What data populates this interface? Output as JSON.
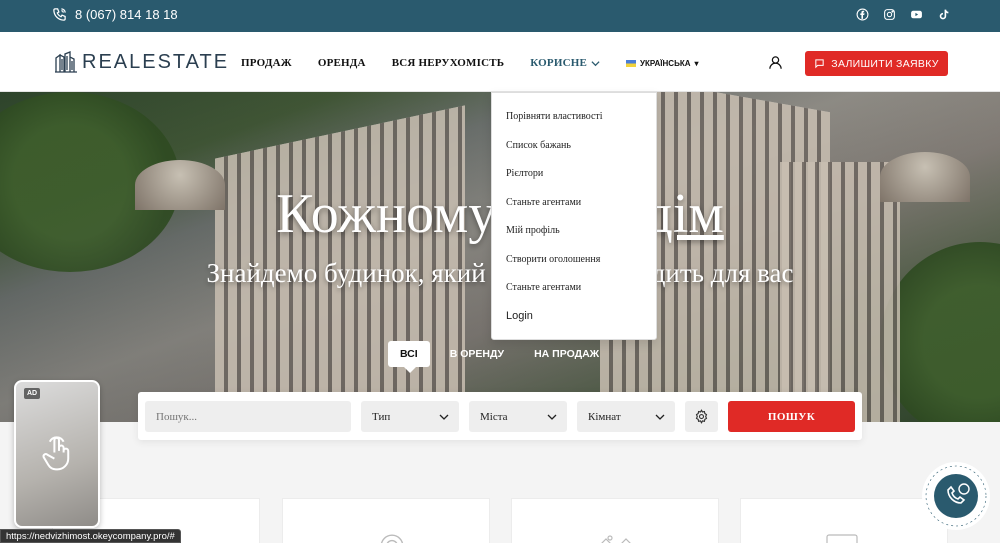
{
  "topbar": {
    "phone": "8 (067) 814 18 18",
    "socials": [
      "facebook-icon",
      "instagram-icon",
      "youtube-icon",
      "tiktok-icon"
    ]
  },
  "header": {
    "logo": "REALESTATE",
    "nav": [
      "ПРОДАЖ",
      "ОРЕНДА",
      "ВСЯ НЕРУХОМІСТЬ",
      "КОРИСНЕ"
    ],
    "language": "УКРАЇНСЬКА",
    "cta": "ЗАЛИШИТИ ЗАЯВКУ"
  },
  "dropdown": {
    "items": [
      "Порівняти властивості",
      "Список бажань",
      "Рієлтори",
      "Станьте агентами",
      "Мій профіль",
      "Створити оголошення",
      "Станьте агентами",
      "Login"
    ]
  },
  "hero": {
    "title_start": "Кожному",
    "title_end": "дім",
    "subtitle_start": "Знайдемо будинок, який",
    "subtitle_end": "дить для вас"
  },
  "tabs": [
    "ВСІ",
    "В ОРЕНДУ",
    "НА ПРОДАЖ"
  ],
  "search": {
    "placeholder": "Пошук...",
    "type": "Тип",
    "city": "Міста",
    "rooms": "Кімнат",
    "button": "ПОШУК"
  },
  "ad": {
    "badge": "AD"
  },
  "status_url": "https://nedvizhimost.okeycompany.pro/#",
  "colors": {
    "topbar": "#2a5a6e",
    "accent": "#e02a26",
    "nav_active": "#2a5a6e"
  }
}
